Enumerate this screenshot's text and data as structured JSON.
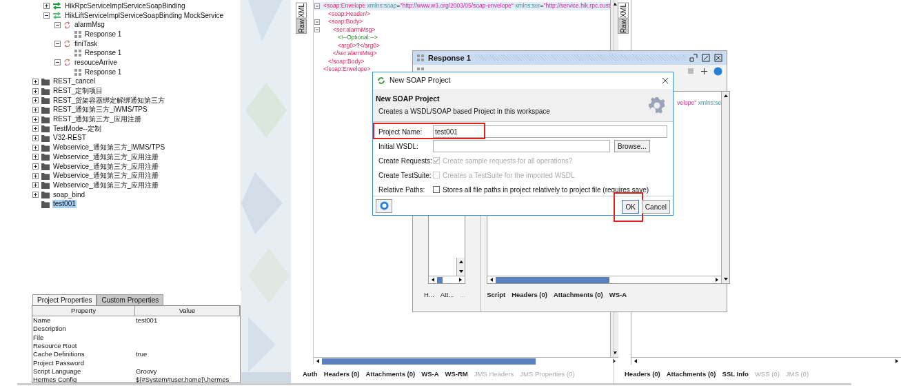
{
  "tree": {
    "cut_off_project_children": [
      {
        "label": "HikRpcServiceImplServiceSoapBinding",
        "kind": "interface",
        "expanded": false,
        "selected": false
      },
      {
        "label": "HikLiftServiceImplServiceSoapBinding MockService",
        "kind": "mock-service",
        "expanded": true,
        "selected": false,
        "children": [
          {
            "label": "alarmMsg",
            "kind": "operation",
            "expanded": true,
            "selected": false,
            "children": [
              {
                "label": "Response 1",
                "kind": "response",
                "selected": false
              }
            ]
          },
          {
            "label": "finiTask",
            "kind": "operation",
            "expanded": true,
            "selected": false,
            "children": [
              {
                "label": "Response 1",
                "kind": "response",
                "selected": false
              }
            ]
          },
          {
            "label": "resouceArrive",
            "kind": "operation",
            "expanded": true,
            "selected": false,
            "children": [
              {
                "label": "Response 1",
                "kind": "response",
                "selected": false
              }
            ]
          }
        ]
      }
    ],
    "items": [
      {
        "label": "REST_cancel",
        "kind": "project",
        "expanded": false,
        "selected": false
      },
      {
        "label": "REST_定制项目",
        "kind": "project",
        "expanded": false,
        "selected": false
      },
      {
        "label": "REST_货架容器绑定解绑通知第三方",
        "kind": "project",
        "expanded": false,
        "selected": false
      },
      {
        "label": "REST_通知第三方_iWMS/TPS",
        "kind": "project",
        "expanded": false,
        "selected": false
      },
      {
        "label": "REST_通知第三方_应用注册",
        "kind": "project",
        "expanded": false,
        "selected": false
      },
      {
        "label": "TestMode--定制",
        "kind": "project",
        "expanded": false,
        "selected": false
      },
      {
        "label": "V32-REST",
        "kind": "project",
        "expanded": false,
        "selected": false
      },
      {
        "label": "Webservice_通知第三方_iWMS/TPS",
        "kind": "project",
        "expanded": false,
        "selected": false
      },
      {
        "label": "Webservice_通知第三方_应用注册",
        "kind": "project",
        "expanded": false,
        "selected": false
      },
      {
        "label": "Webservice_通知第三方_应用注册",
        "kind": "project",
        "expanded": false,
        "selected": false
      },
      {
        "label": "Webservice_通知第三方_应用注册",
        "kind": "project",
        "expanded": false,
        "selected": false
      },
      {
        "label": "Webservice_通知第三方_应用注册",
        "kind": "project",
        "expanded": false,
        "selected": false
      },
      {
        "label": "soap_bind",
        "kind": "project",
        "expanded": false,
        "selected": false
      },
      {
        "label": "test001",
        "kind": "project",
        "selected": true
      }
    ]
  },
  "properties": {
    "tabs": [
      {
        "label": "Project Properties",
        "selected": true
      },
      {
        "label": "Custom Properties",
        "selected": false
      }
    ],
    "columns": [
      "Property",
      "Value"
    ],
    "rows": [
      {
        "property": "Name",
        "value": "test001"
      },
      {
        "property": "Description"
      },
      {
        "property": "File"
      },
      {
        "property": "Resource Root"
      },
      {
        "property": "Cache Definitions",
        "value": "true"
      },
      {
        "property": "Project Password"
      },
      {
        "property": "Script Language",
        "value": "Groovy"
      },
      {
        "property": "Hermes Config",
        "value": "${#System#user.home}\\.hermes"
      }
    ]
  },
  "request_editor": {
    "side_tabs": [
      {
        "label": "XML",
        "selected": true
      },
      {
        "label": "Raw",
        "selected": false
      }
    ],
    "xml": [
      {
        "selected": true,
        "fold": true,
        "segments": [
          {
            "kind": "tag",
            "text": "<soap:Envelope"
          },
          {
            "kind": "attr",
            "text": " xmlns:soap"
          },
          {
            "kind": "text",
            "text": "="
          },
          {
            "kind": "value",
            "text": "\"http://www.w3.org/2003/05/soap-envelope\""
          },
          {
            "kind": "attr",
            "text": " xmlns:ser"
          },
          {
            "kind": "text",
            "text": "="
          },
          {
            "kind": "value",
            "text": "\"http://service.hik.rpc.cust"
          }
        ],
        "children": [
          {
            "selected": false,
            "fold": false,
            "segments": [
              {
                "kind": "tag",
                "text": "<soap:Header/>"
              }
            ]
          },
          {
            "selected": false,
            "fold": true,
            "segments": [
              {
                "kind": "tag",
                "text": "<soap:Body>"
              }
            ],
            "children": [
              {
                "selected": false,
                "fold": true,
                "segments": [
                  {
                    "kind": "tag",
                    "text": "<ser:alarmMsg>"
                  }
                ],
                "children": [
                  {
                    "selected": false,
                    "fold": false,
                    "segments": [
                      {
                        "kind": "comment",
                        "text": "<!--Optional:-->"
                      }
                    ]
                  },
                  {
                    "selected": false,
                    "fold": false,
                    "segments": [
                      {
                        "kind": "tag",
                        "text": "<arg0>"
                      },
                      {
                        "kind": "text",
                        "text": "?"
                      },
                      {
                        "kind": "tag",
                        "text": "</arg0>"
                      }
                    ]
                  }
                ],
                "close": [
                  {
                    "kind": "tag",
                    "text": "</ser:alarmMsg>"
                  }
                ]
              }
            ],
            "close": [
              {
                "kind": "tag",
                "text": "</soap:Body>"
              }
            ]
          }
        ],
        "close": [
          {
            "kind": "tag",
            "text": "</soap:Envelope>"
          }
        ]
      }
    ],
    "bottom_tabs": [
      {
        "label": "Auth",
        "disabled": false
      },
      {
        "label": "Headers (0)",
        "disabled": false
      },
      {
        "label": "Attachments (0)",
        "disabled": false
      },
      {
        "label": "WS-A",
        "disabled": false
      },
      {
        "label": "WS-RM",
        "disabled": false
      },
      {
        "label": "JMS Headers",
        "disabled": true
      },
      {
        "label": "JMS Properties (0)",
        "disabled": true
      }
    ]
  },
  "response_editor": {
    "side_tabs": [
      {
        "label": "XML",
        "selected": true
      },
      {
        "label": "Raw",
        "selected": false
      }
    ],
    "bottom_tabs": [
      {
        "label": "Headers (0)",
        "disabled": false
      },
      {
        "label": "Attachments (0)",
        "disabled": false
      },
      {
        "label": "SSL Info",
        "disabled": false
      },
      {
        "label": "WSS (0)",
        "disabled": true
      },
      {
        "label": "JMS (0)",
        "disabled": true
      }
    ]
  },
  "response_window": {
    "title": "Response 1",
    "xml_segments": [
      {
        "kind": "value",
        "text": "velope\""
      },
      {
        "kind": "attr",
        "text": " xmlns:se"
      }
    ],
    "left_tabs": [
      {
        "label": "H...",
        "disabled": false
      },
      {
        "label": "Att...",
        "disabled": false
      },
      {
        "label": "...",
        "disabled": true
      }
    ],
    "bottom_tabs": [
      {
        "label": "Script",
        "disabled": false
      },
      {
        "label": "Headers (0)",
        "disabled": false
      },
      {
        "label": "Attachments (0)",
        "disabled": false
      },
      {
        "label": "WS-A",
        "disabled": false
      }
    ]
  },
  "dialog": {
    "title": "New SOAP Project",
    "heading": "New SOAP Project",
    "description": "Creates a WSDL/SOAP based Project in this workspace",
    "fields": [
      {
        "kind": "text",
        "label": "Project Name:",
        "value": "test001",
        "highlighted": true
      },
      {
        "kind": "file",
        "label": "Initial WSDL:",
        "button": "Browse..."
      },
      {
        "kind": "checkbox",
        "label": "Create Requests:",
        "text": "Create sample requests for all operations?",
        "checked": true,
        "disabled": true
      },
      {
        "kind": "checkbox",
        "label": "Create TestSuite:",
        "text": "Creates a TestSuite for the imported WSDL",
        "checked": false,
        "disabled": true
      },
      {
        "kind": "checkbox",
        "label": "Relative Paths:",
        "text": "Stores all file paths in project relatively to project file (requires save)",
        "checked": false,
        "disabled": false
      }
    ],
    "buttons": [
      {
        "kind": "help"
      },
      {
        "kind": "text",
        "label": "OK",
        "highlighted": true
      },
      {
        "kind": "text",
        "label": "Cancel"
      }
    ]
  }
}
